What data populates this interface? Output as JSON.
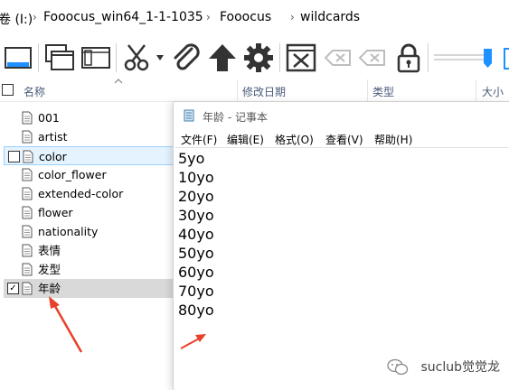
{
  "breadcrumb": {
    "drive": "卷 (I:)",
    "items": [
      "Fooocus_win64_1-1-1035",
      "Fooocus",
      "wildcards"
    ]
  },
  "columns": {
    "name": "名称",
    "modified": "修改日期",
    "type": "类型",
    "size": "大小"
  },
  "files": [
    {
      "label": "001"
    },
    {
      "label": "artist"
    },
    {
      "label": "color"
    },
    {
      "label": "color_flower"
    },
    {
      "label": "extended-color"
    },
    {
      "label": "flower"
    },
    {
      "label": "nationality"
    },
    {
      "label": "表情"
    },
    {
      "label": "发型"
    },
    {
      "label": "年龄"
    }
  ],
  "notepad": {
    "title": "年龄 - 记事本",
    "menu": [
      "文件(F)",
      "编辑(E)",
      "格式(O)",
      "查看(V)",
      "帮助(H)"
    ],
    "lines": [
      "5yo",
      "10yo",
      "20yo",
      "30yo",
      "40yo",
      "50yo",
      "60yo",
      "70yo",
      "80yo"
    ]
  },
  "watermark": {
    "text": "suclub觉觉龙"
  },
  "colors": {
    "accent": "#1e90ff",
    "arrow": "#e8402a",
    "selected_row": "#d9d9d9",
    "hover_row": "#e5f3ff"
  },
  "icons": [
    "panel-icon",
    "new-window-icon",
    "window-icon",
    "scissors-icon",
    "paperclip-icon",
    "up-arrow-icon",
    "gear-icon",
    "close-box-icon",
    "backspace-icon",
    "lock-icon",
    "slider-icon"
  ]
}
